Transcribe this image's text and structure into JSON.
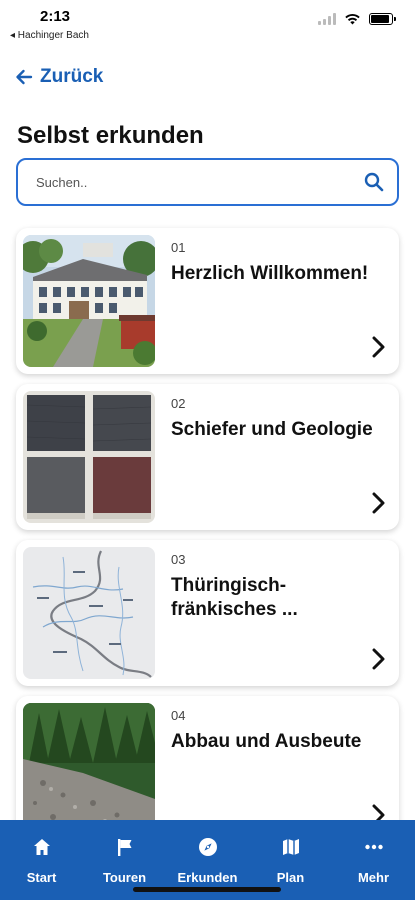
{
  "status_bar": {
    "time": "2:13",
    "back_app": "◂ Hachinger Bach"
  },
  "nav": {
    "back_label": "Zurück"
  },
  "page": {
    "title": "Selbst erkunden"
  },
  "search": {
    "placeholder": "Suchen.."
  },
  "cards": [
    {
      "number": "01",
      "title": "Herzlich Willkommen!",
      "thumb": "building-photo"
    },
    {
      "number": "02",
      "title": "Schiefer und Geologie",
      "thumb": "slate-samples-photo"
    },
    {
      "number": "03",
      "title": "Thüringisch-fränkisches ...",
      "thumb": "map-photo"
    },
    {
      "number": "04",
      "title": "Abbau und Ausbeute",
      "thumb": "quarry-photo"
    }
  ],
  "tabbar": {
    "items": [
      {
        "label": "Start",
        "icon": "home-icon"
      },
      {
        "label": "Touren",
        "icon": "flag-icon"
      },
      {
        "label": "Erkunden",
        "icon": "compass-icon"
      },
      {
        "label": "Plan",
        "icon": "map-icon"
      },
      {
        "label": "Mehr",
        "icon": "more-icon"
      }
    ]
  },
  "colors": {
    "accent": "#1a5fb4",
    "search_border": "#2a6fd4"
  }
}
